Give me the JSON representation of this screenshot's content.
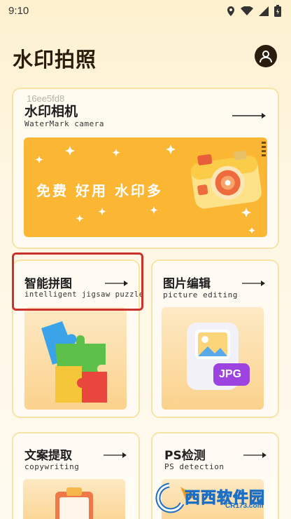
{
  "status_bar": {
    "time": "9:10"
  },
  "header": {
    "title": "水印拍照"
  },
  "hero": {
    "watermark_id": "16ee5fd8",
    "title": "水印相机",
    "subtitle": "WaterMark camera",
    "slogan": "免费 好用 水印多"
  },
  "features": [
    {
      "title": "智能拼图",
      "subtitle": "intelligent jigsaw puzzle"
    },
    {
      "title": "图片编辑",
      "subtitle": "picture editing",
      "badge": "JPG"
    },
    {
      "title": "文案提取",
      "subtitle": "copywriting"
    },
    {
      "title": "PS检测",
      "subtitle": "PS detection"
    }
  ],
  "overlay_logo": {
    "name": "西西软件园",
    "url": "CR173.com"
  },
  "colors": {
    "accent": "#fbb633",
    "card_border": "#f8e3a6",
    "highlight": "#c9332b",
    "title": "#2b1d0e"
  }
}
